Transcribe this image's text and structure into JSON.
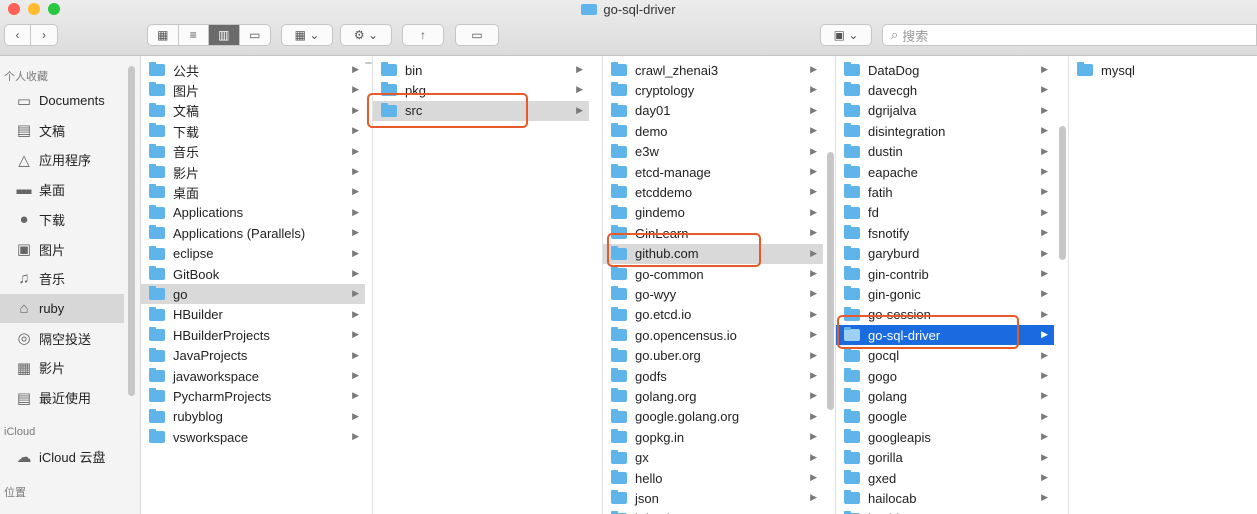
{
  "window": {
    "title": "go-sql-driver",
    "traffic_colors": [
      "#fe5f57",
      "#febc2e",
      "#28c840"
    ]
  },
  "toolbar": {
    "nav": {
      "back": "back-icon",
      "forward": "forward-icon"
    },
    "view_modes": [
      {
        "name": "view-icon-mode",
        "icon": "grid-icon",
        "active": false
      },
      {
        "name": "view-list-mode",
        "icon": "list-icon",
        "active": false
      },
      {
        "name": "view-column-mode",
        "icon": "columns-icon",
        "active": true
      },
      {
        "name": "view-gallery-mode",
        "icon": "gallery-icon",
        "active": false
      }
    ],
    "group_icon": "group-icon",
    "action_icon": "gear-icon",
    "share_icon": "share-icon",
    "tag_icon": "tag-icon",
    "search": {
      "placeholder": "搜索"
    }
  },
  "sidebar": {
    "favorites_header": "个人收藏",
    "favorites": [
      {
        "label": "Documents",
        "icon": "folder-icon",
        "selected": false
      },
      {
        "label": "文稿",
        "icon": "document-icon",
        "selected": false
      },
      {
        "label": "应用程序",
        "icon": "applications-icon",
        "selected": false
      },
      {
        "label": "桌面",
        "icon": "desktop-icon",
        "selected": false
      },
      {
        "label": "下载",
        "icon": "download-icon",
        "selected": false
      },
      {
        "label": "图片",
        "icon": "camera-icon",
        "selected": false
      },
      {
        "label": "音乐",
        "icon": "music-icon",
        "selected": false
      },
      {
        "label": "ruby",
        "icon": "home-icon",
        "selected": true
      },
      {
        "label": "隔空投送",
        "icon": "airdrop-icon",
        "selected": false
      },
      {
        "label": "影片",
        "icon": "film-icon",
        "selected": false
      },
      {
        "label": "最近使用",
        "icon": "recents-icon",
        "selected": false
      }
    ],
    "icloud_header": "iCloud",
    "icloud": [
      {
        "label": "iCloud 云盘",
        "icon": "cloud-icon"
      }
    ],
    "locations_header": "位置"
  },
  "columns": [
    {
      "items": [
        "公共",
        "图片",
        "文稿",
        "下载",
        "音乐",
        "影片",
        "桌面",
        "Applications",
        "Applications (Parallels)",
        "eclipse",
        "GitBook",
        "go",
        "HBuilder",
        "HBuilderProjects",
        "JavaProjects",
        "javaworkspace",
        "PycharmProjects",
        "rubyblog",
        "vsworkspace"
      ],
      "selected_index": 11,
      "selection_style": "gray"
    },
    {
      "items": [
        "bin",
        "pkg",
        "src"
      ],
      "selected_index": 2,
      "selection_style": "gray"
    },
    {
      "items": [
        "crawl_zhenai3",
        "cryptology",
        "day01",
        "demo",
        "e3w",
        "etcd-manage",
        "etcddemo",
        "gindemo",
        "GinLearn",
        "github.com",
        "go-common",
        "go-wyy",
        "go.etcd.io",
        "go.opencensus.io",
        "go.uber.org",
        "godfs",
        "golang.org",
        "google.golang.org",
        "gopkg.in",
        "gx",
        "hello",
        "json",
        "k-basic"
      ],
      "selected_index": 9,
      "selection_style": "gray"
    },
    {
      "items": [
        "DataDog",
        "davecgh",
        "dgrijalva",
        "disintegration",
        "dustin",
        "eapache",
        "fatih",
        "fd",
        "fsnotify",
        "garyburd",
        "gin-contrib",
        "gin-gonic",
        "go-session",
        "go-sql-driver",
        "gocql",
        "gogo",
        "golang",
        "google",
        "googleapis",
        "gorilla",
        "gxed",
        "hailocab",
        "hashicorp"
      ],
      "selected_index": 13,
      "selection_style": "blue"
    },
    {
      "items": [
        "mysql"
      ],
      "selected_index": -1,
      "selection_style": "none"
    }
  ],
  "annotation_color": "#e65a2b"
}
